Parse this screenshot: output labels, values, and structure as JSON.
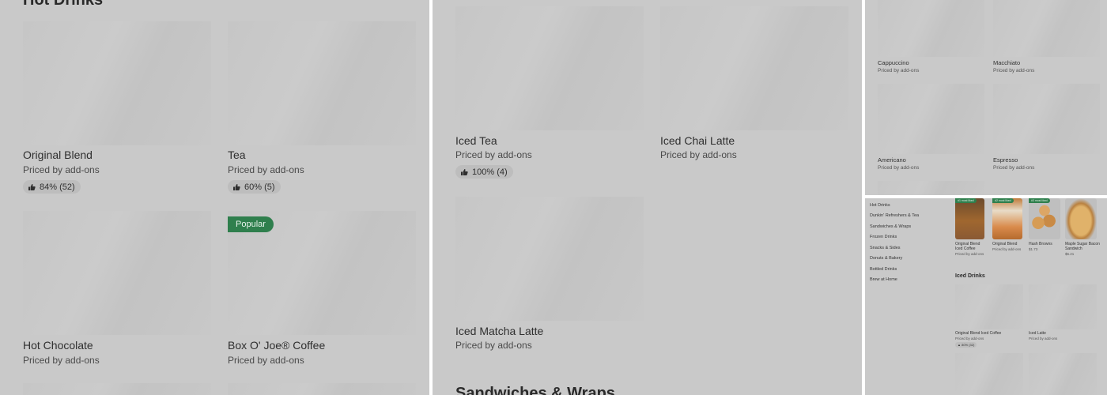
{
  "panel1": {
    "heading": "Hot Drinks",
    "items": [
      {
        "name": "Original Blend",
        "price": "Priced by add-ons",
        "rating": "84% (52)"
      },
      {
        "name": "Tea",
        "price": "Priced by add-ons",
        "rating": "60% (5)"
      },
      {
        "name": "Hot Chocolate",
        "price": "Priced by add-ons"
      },
      {
        "name": "Box O' Joe® Coffee",
        "price": "Priced by add-ons",
        "badge": "Popular"
      }
    ]
  },
  "panel2": {
    "items": [
      {
        "name": "Iced Tea",
        "price": "Priced by add-ons",
        "rating": "100% (4)"
      },
      {
        "name": "Iced Chai Latte",
        "price": "Priced by add-ons"
      },
      {
        "name": "Iced Matcha Latte",
        "price": "Priced by add-ons"
      }
    ],
    "next_heading": "Sandwiches & Wraps"
  },
  "panel3": {
    "items": [
      {
        "name": "Cappuccino",
        "price": "Priced by add-ons"
      },
      {
        "name": "Macchiato",
        "price": "Priced by add-ons"
      },
      {
        "name": "Americano",
        "price": "Priced by add-ons"
      },
      {
        "name": "Espresso",
        "price": "Priced by add-ons"
      }
    ]
  },
  "panel4": {
    "sidebar": [
      "Hot Drinks",
      "Dunkin' Refreshers & Tea",
      "Sandwiches & Wraps",
      "Frozen Drinks",
      "Snacks & Sides",
      "Donuts & Bakery",
      "Bottled Drinks",
      "Brew at Home"
    ],
    "featured": [
      {
        "name": "Original Blend Iced Coffee",
        "price": "Priced by add-ons",
        "badge": "#1 most liked"
      },
      {
        "name": "Original Blend",
        "price": "Priced by add-ons",
        "badge": "#2 most liked"
      },
      {
        "name": "Hash Browns",
        "price": "$1.73",
        "badge": "#3 most liked"
      },
      {
        "name": "Maple Sugar Bacon Sandwich",
        "price": "$6.21"
      }
    ],
    "section_title": "Iced Drinks",
    "items": [
      {
        "name": "Original Blend Iced Coffee",
        "price": "Priced by add-ons",
        "rating": "80% (32)"
      },
      {
        "name": "Iced Latte",
        "price": "Priced by add-ons"
      }
    ]
  },
  "colors": {
    "overlay_gray": "#c9c9c9",
    "badge_green": "#2f7f4d",
    "divider": "#ffffff"
  },
  "icons": {
    "rating": "thumbs-up-icon"
  }
}
